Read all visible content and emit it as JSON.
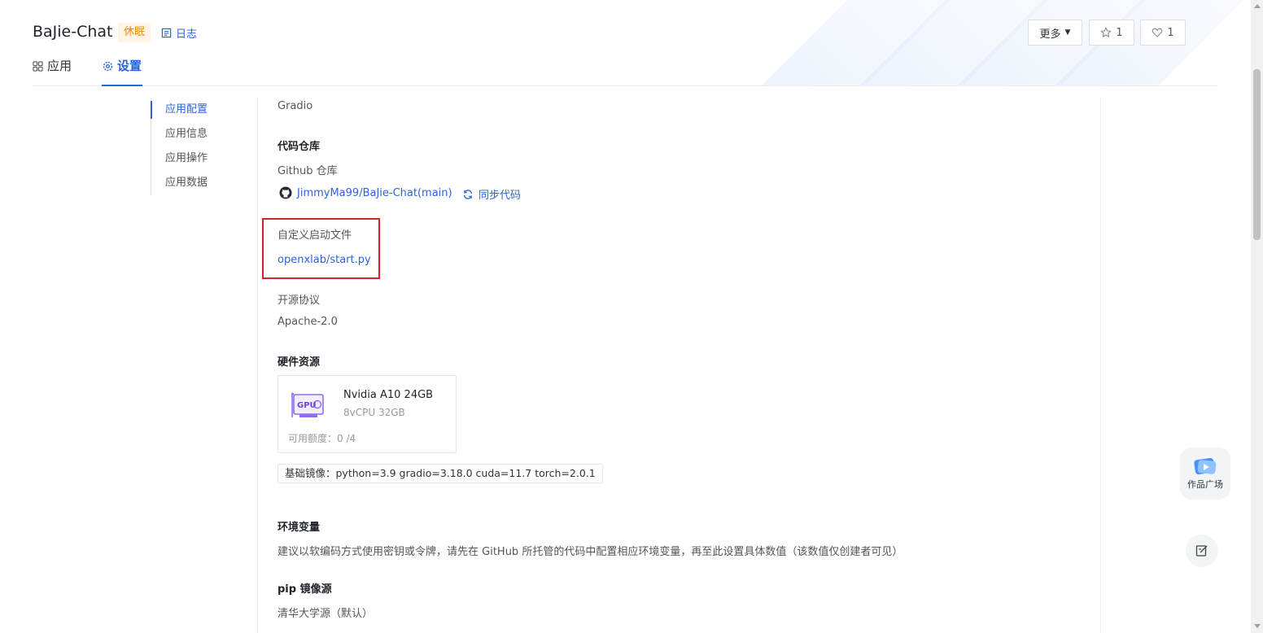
{
  "header": {
    "app_title": "BaJie-Chat",
    "status": "休眠",
    "log_label": "日志",
    "tabs": [
      {
        "label": "应用",
        "icon": "grid-icon",
        "active": false
      },
      {
        "label": "设置",
        "icon": "gear-icon",
        "active": true
      }
    ],
    "more_label": "更多",
    "star_count": "1",
    "like_count": "1"
  },
  "side_nav": {
    "items": [
      {
        "label": "应用配置",
        "active": true
      },
      {
        "label": "应用信息",
        "active": false
      },
      {
        "label": "应用操作",
        "active": false
      },
      {
        "label": "应用数据",
        "active": false
      }
    ]
  },
  "config": {
    "sdk": "Gradio",
    "repo_heading": "代码仓库",
    "repo_type": "Github 仓库",
    "repo_link": "JimmyMa99/BaJie-Chat(main)",
    "sync_label": "同步代码",
    "startup_label": "自定义启动文件",
    "startup_file": "openxlab/start.py",
    "license_label": "开源协议",
    "license_value": "Apache-2.0",
    "hardware_heading": "硬件资源",
    "hardware": {
      "gpu_label": "GPU",
      "name": "Nvidia A10  24GB",
      "spec": "8vCPU  32GB",
      "quota": "可用额度：0  /4"
    },
    "base_image": "基础镜像：python=3.9 gradio=3.18.0 cuda=11.7 torch=2.0.1",
    "env_heading": "环境变量",
    "env_desc": "建议以软编码方式使用密钥或令牌，请先在 GitHub 所托管的代码中配置相应环境变量，再至此设置具体数值（该数值仅创建者可见）",
    "pip_heading": "pip 镜像源",
    "pip_value": "清华大学源（默认）"
  },
  "floating": {
    "gallery_label": "作品广场"
  },
  "colors": {
    "accent": "#2c63d8",
    "status_bg": "#fff4e5",
    "status_text": "#f08c00",
    "highlight": "#d9232a"
  }
}
